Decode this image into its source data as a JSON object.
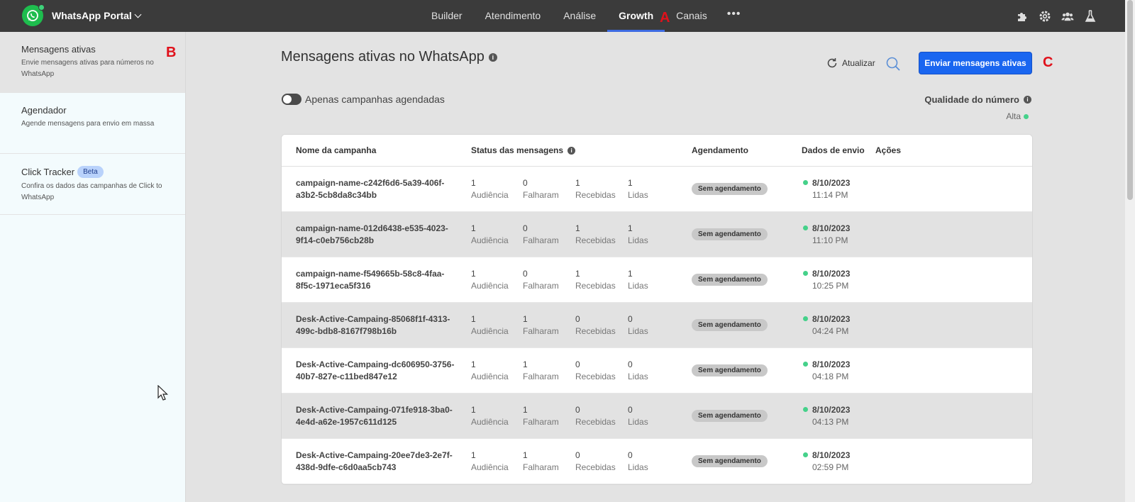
{
  "app": {
    "title": "WhatsApp Portal"
  },
  "nav": {
    "items": [
      "Builder",
      "Atendimento",
      "Análise",
      "Growth",
      "Canais"
    ],
    "active": "Growth",
    "more": "•••"
  },
  "markers": {
    "a": "A",
    "b": "B",
    "c": "C"
  },
  "top_icons": [
    "puzzle-icon",
    "gear-icon",
    "users-icon",
    "flask-icon"
  ],
  "sidebar": {
    "items": [
      {
        "title": "Mensagens ativas",
        "desc": "Envie mensagens ativas para números no WhatsApp"
      },
      {
        "title": "Agendador",
        "desc": "Agende mensagens para envio em massa"
      },
      {
        "title": "Click Tracker",
        "badge": "Beta",
        "desc": "Confira os dados das campanhas de Click to WhatsApp"
      }
    ]
  },
  "main": {
    "title": "Mensagens ativas no WhatsApp",
    "refresh_label": "Atualizar",
    "send_button": "Enviar mensagens ativas",
    "toggle_label": "Apenas campanhas agendadas",
    "quality_label": "Qualidade do número",
    "quality_value": "Alta"
  },
  "table": {
    "headers": {
      "name": "Nome da campanha",
      "status": "Status das mensagens",
      "schedule": "Agendamento",
      "send_data": "Dados de envio",
      "actions": "Ações"
    },
    "stat_labels": [
      "Audiência",
      "Falharam",
      "Recebidas",
      "Lidas"
    ],
    "schedule_badge": "Sem agendamento",
    "rows": [
      {
        "name": "campaign-name-c242f6d6-5a39-406f-a3b2-5cb8da8c34bb",
        "stats": [
          "1",
          "0",
          "1",
          "1"
        ],
        "date": "8/10/2023",
        "time": "11:14 PM"
      },
      {
        "name": "campaign-name-012d6438-e535-4023-9f14-c0eb756cb28b",
        "stats": [
          "1",
          "0",
          "1",
          "1"
        ],
        "date": "8/10/2023",
        "time": "11:10 PM"
      },
      {
        "name": "campaign-name-f549665b-58c8-4faa-8f5c-1971eca5f316",
        "stats": [
          "1",
          "0",
          "1",
          "1"
        ],
        "date": "8/10/2023",
        "time": "10:25 PM"
      },
      {
        "name": "Desk-Active-Campaing-85068f1f-4313-499c-bdb8-8167f798b16b",
        "stats": [
          "1",
          "1",
          "0",
          "0"
        ],
        "date": "8/10/2023",
        "time": "04:24 PM"
      },
      {
        "name": "Desk-Active-Campaing-dc606950-3756-40b7-827e-c11bed847e12",
        "stats": [
          "1",
          "1",
          "0",
          "0"
        ],
        "date": "8/10/2023",
        "time": "04:18 PM"
      },
      {
        "name": "Desk-Active-Campaing-071fe918-3ba0-4e4d-a62e-1957c611d125",
        "stats": [
          "1",
          "1",
          "0",
          "0"
        ],
        "date": "8/10/2023",
        "time": "04:13 PM"
      },
      {
        "name": "Desk-Active-Campaing-20ee7de3-2e7f-438d-9dfe-c6d0aa5cb743",
        "stats": [
          "1",
          "1",
          "0",
          "0"
        ],
        "date": "8/10/2023",
        "time": "02:59 PM"
      }
    ]
  },
  "colors": {
    "topbar": "#3b3b3b",
    "accent": "#1a66f0",
    "status_green": "#45d18a",
    "marker_red": "#e0111b"
  }
}
